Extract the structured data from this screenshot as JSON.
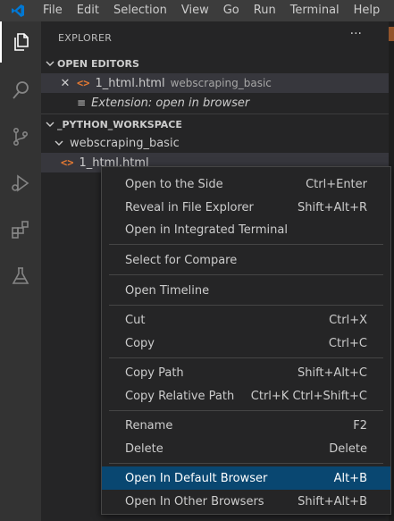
{
  "menubar": {
    "items": [
      "File",
      "Edit",
      "Selection",
      "View",
      "Go",
      "Run",
      "Terminal",
      "Help"
    ]
  },
  "activitybar": {
    "icons": [
      "explorer-icon",
      "search-icon",
      "source-control-icon",
      "run-debug-icon",
      "extensions-icon",
      "testing-icon"
    ]
  },
  "explorer": {
    "title": "EXPLORER",
    "more": "···",
    "open_editors": {
      "header": "OPEN EDITORS",
      "items": [
        {
          "name": "1_html.html",
          "description": "webscraping_basic"
        },
        {
          "name": "Extension: open in browser"
        }
      ]
    },
    "workspace": {
      "header": "_PYTHON_WORKSPACE",
      "folder": "webscraping_basic",
      "file": "1_html.html"
    }
  },
  "context_menu": {
    "items": [
      {
        "label": "Open to the Side",
        "shortcut": "Ctrl+Enter"
      },
      {
        "label": "Reveal in File Explorer",
        "shortcut": "Shift+Alt+R"
      },
      {
        "label": "Open in Integrated Terminal",
        "shortcut": ""
      },
      {
        "label": "Select for Compare",
        "shortcut": ""
      },
      {
        "label": "Open Timeline",
        "shortcut": ""
      },
      {
        "label": "Cut",
        "shortcut": "Ctrl+X"
      },
      {
        "label": "Copy",
        "shortcut": "Ctrl+C"
      },
      {
        "label": "Copy Path",
        "shortcut": "Shift+Alt+C"
      },
      {
        "label": "Copy Relative Path",
        "shortcut": "Ctrl+K Ctrl+Shift+C"
      },
      {
        "label": "Rename",
        "shortcut": "F2"
      },
      {
        "label": "Delete",
        "shortcut": "Delete"
      },
      {
        "label": "Open In Default Browser",
        "shortcut": "Alt+B"
      },
      {
        "label": "Open In Other Browsers",
        "shortcut": "Shift+Alt+B"
      }
    ],
    "highlighted": "Open In Default Browser"
  },
  "colors": {
    "accent": "#094771",
    "html_icon": "#e37933",
    "logo": "#0078d4"
  }
}
